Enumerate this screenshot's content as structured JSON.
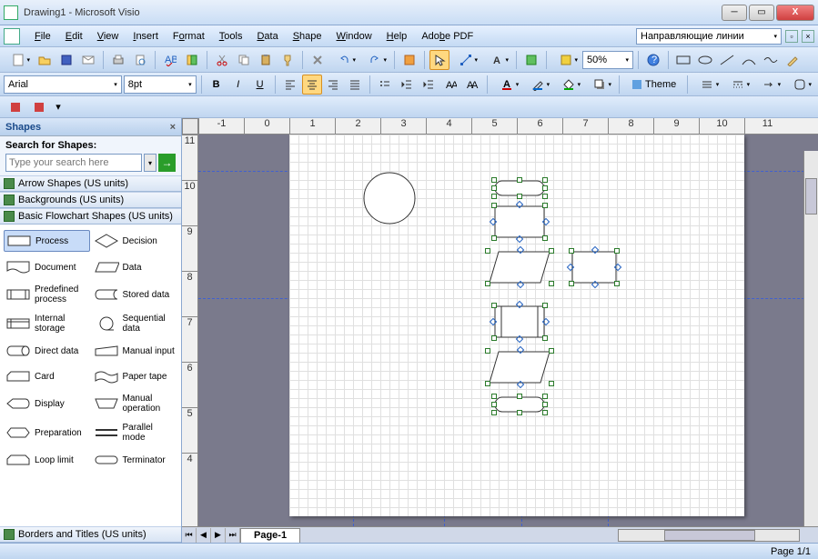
{
  "window": {
    "title": "Drawing1 - Microsoft Visio"
  },
  "menu": {
    "file": "File",
    "edit": "Edit",
    "view": "View",
    "insert": "Insert",
    "format": "Format",
    "tools": "Tools",
    "data": "Data",
    "shape": "Shape",
    "window": "Window",
    "help": "Help",
    "adobe": "Adobe PDF",
    "combo_text": "Направляющие линии"
  },
  "toolbar": {
    "font": "Arial",
    "size": "8pt",
    "zoom": "50%",
    "theme": "Theme"
  },
  "shapes_panel": {
    "title": "Shapes",
    "search_label": "Search for Shapes:",
    "search_placeholder": "Type your search here",
    "stencils": [
      "Arrow Shapes (US units)",
      "Backgrounds (US units)",
      "Basic Flowchart Shapes (US units)",
      "Borders and Titles (US units)"
    ],
    "shapes": [
      {
        "name": "Process",
        "sel": true
      },
      {
        "name": "Decision"
      },
      {
        "name": "Document"
      },
      {
        "name": "Data"
      },
      {
        "name": "Predefined process"
      },
      {
        "name": "Stored data"
      },
      {
        "name": "Internal storage"
      },
      {
        "name": "Sequential data"
      },
      {
        "name": "Direct data"
      },
      {
        "name": "Manual input"
      },
      {
        "name": "Card"
      },
      {
        "name": "Paper tape"
      },
      {
        "name": "Display"
      },
      {
        "name": "Manual operation"
      },
      {
        "name": "Preparation"
      },
      {
        "name": "Parallel mode"
      },
      {
        "name": "Loop limit"
      },
      {
        "name": "Terminator"
      }
    ]
  },
  "page": {
    "tab": "Page-1",
    "status": "Page 1/1"
  },
  "ruler_h": [
    "-1",
    "0",
    "1",
    "2",
    "3",
    "4",
    "5",
    "6",
    "7",
    "8",
    "9",
    "10",
    "11"
  ],
  "ruler_v": [
    "11",
    "10",
    "9",
    "8",
    "7",
    "6",
    "5",
    "4"
  ]
}
